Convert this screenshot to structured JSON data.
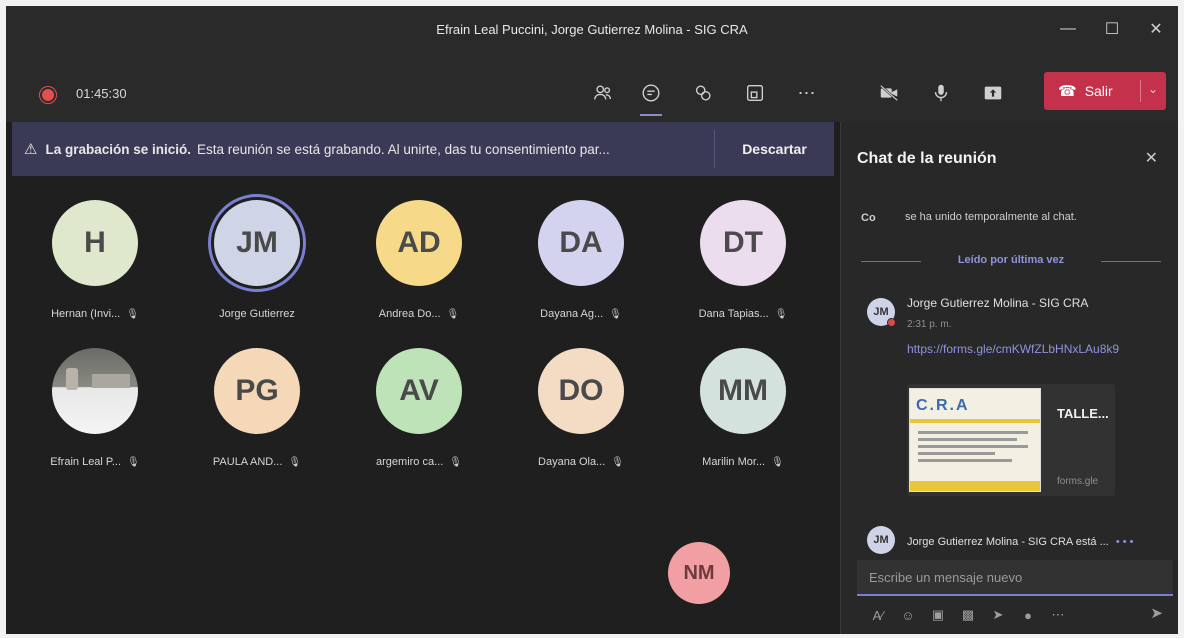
{
  "window": {
    "title": "Efrain Leal Puccini, Jorge Gutierrez Molina - SIG CRA"
  },
  "toolbar": {
    "timer": "01:45:30",
    "leave_label": "Salir",
    "icons": [
      "participants-icon",
      "chat-icon",
      "reactions-icon",
      "share-tray-icon",
      "more-icon",
      "camera-off-icon",
      "mic-icon",
      "share-screen-icon"
    ]
  },
  "banner": {
    "title": "La grabación se inició.",
    "text": "Esta reunión se está grabando. Al unirte, das tu consentimiento par...",
    "dismiss_label": "Descartar"
  },
  "participants": [
    {
      "initials": "H",
      "name": "Hernan (Invi...",
      "color": "#dfe8cc",
      "muted": true
    },
    {
      "initials": "JM",
      "name": "Jorge Gutierrez",
      "color": "#cfd4e6",
      "muted": false,
      "speaking": true
    },
    {
      "initials": "AD",
      "name": "Andrea Do...",
      "color": "#f6d989",
      "muted": true
    },
    {
      "initials": "DA",
      "name": "Dayana Ag...",
      "color": "#d4d3ef",
      "muted": true
    },
    {
      "initials": "DT",
      "name": "Dana Tapias...",
      "color": "#ebdcee",
      "muted": true
    },
    {
      "initials": "",
      "name": "Efrain Leal P...",
      "color": "#9a9a9a",
      "muted": true,
      "photo": true
    },
    {
      "initials": "PG",
      "name": "PAULA AND...",
      "color": "#f5d8b8",
      "muted": true
    },
    {
      "initials": "AV",
      "name": "argemiro ca...",
      "color": "#bfe3b8",
      "muted": true
    },
    {
      "initials": "DO",
      "name": "Dayana Ola...",
      "color": "#f4dcc4",
      "muted": true
    },
    {
      "initials": "MM",
      "name": "Marilin Mor...",
      "color": "#d3e2dd",
      "muted": true
    }
  ],
  "overflow_participant": {
    "initials": "NM"
  },
  "chat": {
    "title": "Chat de la reunión",
    "system_initials": "Co",
    "system_message": "se ha unido temporalmente al chat.",
    "read_marker": "Leído por última vez",
    "message": {
      "avatar_initials": "JM",
      "sender": "Jorge Gutierrez Molina - SIG CRA",
      "time": "2:31 p. m.",
      "link": "https://forms.gle/cmKWfZLbHNxLAu8k9",
      "card_logo": "C.R.A",
      "card_title": "TALLE...",
      "card_domain": "forms.gle"
    },
    "typing_avatar": "JM",
    "typing_text": "Jorge Gutierrez Molina - SIG CRA está ...",
    "typing_dots": "• • •",
    "compose_placeholder": "Escribe un mensaje nuevo",
    "compose_tools": [
      "format-icon",
      "emoji-icon",
      "gif-icon",
      "sticker-icon",
      "meet-now-icon",
      "praise-icon",
      "more-options-icon"
    ]
  }
}
